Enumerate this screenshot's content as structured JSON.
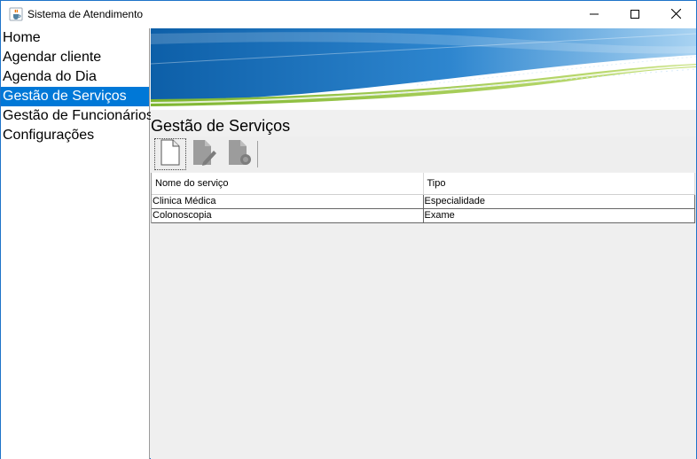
{
  "window": {
    "title": "Sistema de Atendimento",
    "app_icon": "java-cup-icon",
    "accent": "#0078d7"
  },
  "sidebar": {
    "items": [
      {
        "label": "Home",
        "selected": false
      },
      {
        "label": "Agendar cliente",
        "selected": false
      },
      {
        "label": "Agenda do Dia",
        "selected": false
      },
      {
        "label": "Gestão de Serviços",
        "selected": true
      },
      {
        "label": "Gestão de Funcionários",
        "selected": false
      },
      {
        "label": "Configurações",
        "selected": false
      }
    ]
  },
  "main": {
    "title": "Gestão de Serviços",
    "toolbar": {
      "buttons": [
        {
          "icon": "new-document-icon",
          "enabled": true
        },
        {
          "icon": "edit-document-icon",
          "enabled": false
        },
        {
          "icon": "delete-document-icon",
          "enabled": false
        }
      ]
    },
    "table": {
      "columns": [
        "Nome do serviço",
        "Tipo"
      ],
      "rows": [
        [
          "Clinica Médica",
          "Especialidade"
        ],
        [
          "Colonoscopia",
          "Exame"
        ]
      ]
    }
  }
}
